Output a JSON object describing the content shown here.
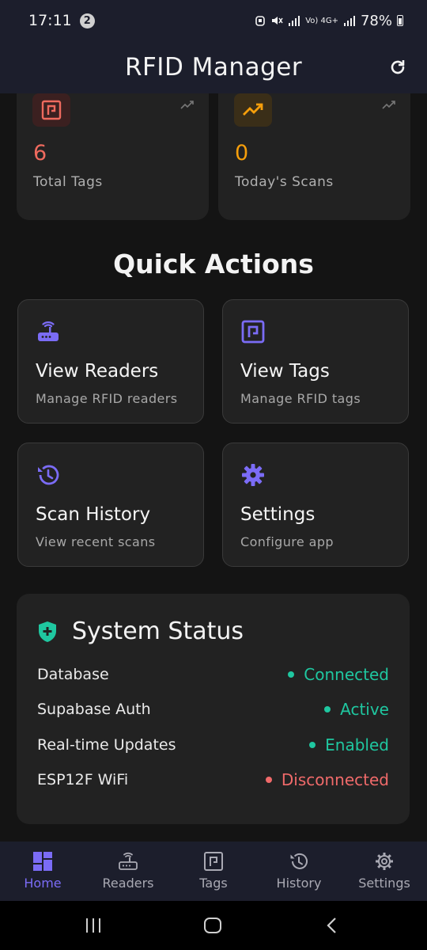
{
  "status_bar": {
    "time": "17:11",
    "notification_count": "2",
    "network": "Vo) 4G+",
    "battery": "78%"
  },
  "app_bar": {
    "title": "RFID Manager"
  },
  "stats": [
    {
      "value": "6",
      "label": "Total Tags",
      "color": "#ef6a5e"
    },
    {
      "value": "0",
      "label": "Today's Scans",
      "color": "#f59e0b"
    }
  ],
  "quick_actions": {
    "title": "Quick Actions",
    "items": [
      {
        "title": "View Readers",
        "subtitle": "Manage RFID readers",
        "icon": "router-icon"
      },
      {
        "title": "View Tags",
        "subtitle": "Manage RFID tags",
        "icon": "nfc-tag-icon"
      },
      {
        "title": "Scan History",
        "subtitle": "View recent scans",
        "icon": "history-icon"
      },
      {
        "title": "Settings",
        "subtitle": "Configure app",
        "icon": "gear-icon"
      }
    ]
  },
  "system_status": {
    "title": "System Status",
    "rows": [
      {
        "name": "Database",
        "value": "Connected",
        "color": "#1fc7a0"
      },
      {
        "name": "Supabase Auth",
        "value": "Active",
        "color": "#1fc7a0"
      },
      {
        "name": "Real-time Updates",
        "value": "Enabled",
        "color": "#1fc7a0"
      },
      {
        "name": "ESP12F WiFi",
        "value": "Disconnected",
        "color": "#f06a6a"
      }
    ]
  },
  "bottom_nav": {
    "active": "Home",
    "items": [
      "Home",
      "Readers",
      "Tags",
      "History",
      "Settings"
    ]
  },
  "colors": {
    "accent": "#7b6cf6",
    "bar_bg": "#1c1e2c",
    "card_bg": "#222222"
  }
}
